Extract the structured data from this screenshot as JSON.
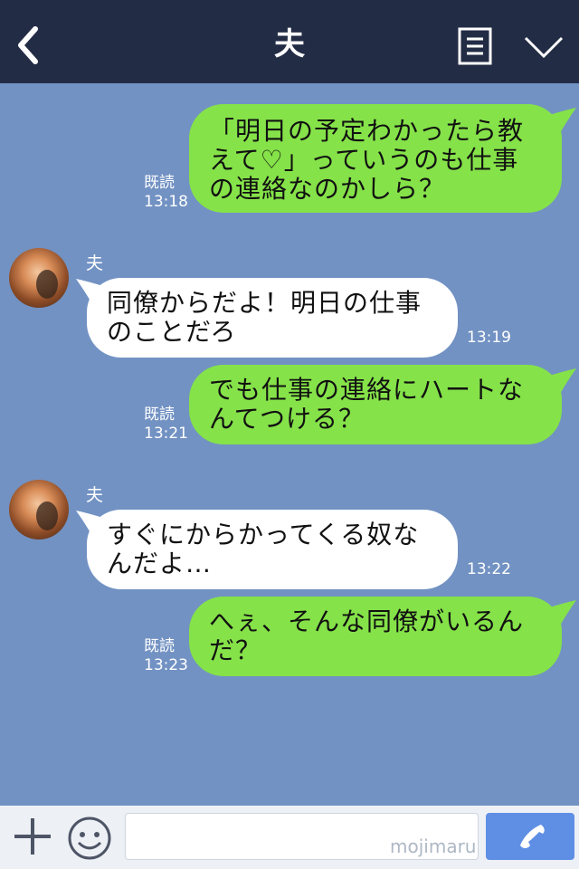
{
  "header": {
    "title": "夫",
    "icons": {
      "back": "back-chevron-icon",
      "notes": "notes-icon",
      "menu": "chevron-down-icon"
    },
    "background_color": "#232c45"
  },
  "chat": {
    "background_color": "#7292c3",
    "messages": [
      {
        "direction": "outgoing",
        "text": "「明日の予定わかったら教\nえて♡」っていうのも仕事\nの連絡なのかしら？",
        "read_status": "既読",
        "time": "13:18",
        "bubble_color": "#85e249"
      },
      {
        "direction": "incoming",
        "sender": "夫",
        "text": "同僚からだよ！明日の仕事\nのことだろ",
        "time": "13:19",
        "bubble_color": "#ffffff"
      },
      {
        "direction": "outgoing",
        "text": "でも仕事の連絡にハートな\nんてつける？",
        "read_status": "既読",
        "time": "13:21",
        "bubble_color": "#85e249"
      },
      {
        "direction": "incoming",
        "sender": "夫",
        "text": "すぐにからかってくる奴な\nんだよ…",
        "time": "13:22",
        "bubble_color": "#ffffff"
      },
      {
        "direction": "outgoing",
        "text": "へぇ、そんな同僚がいるん\nだ？",
        "read_status": "既読",
        "time": "13:23",
        "bubble_color": "#85e249"
      }
    ]
  },
  "footer": {
    "watermark": "mojimaru",
    "message_input": {
      "value": "",
      "placeholder": ""
    },
    "icons": {
      "add": "plus-icon",
      "emoji": "emoji-icon",
      "call": "phone-icon"
    },
    "call_button_color": "#5f8fe4"
  }
}
